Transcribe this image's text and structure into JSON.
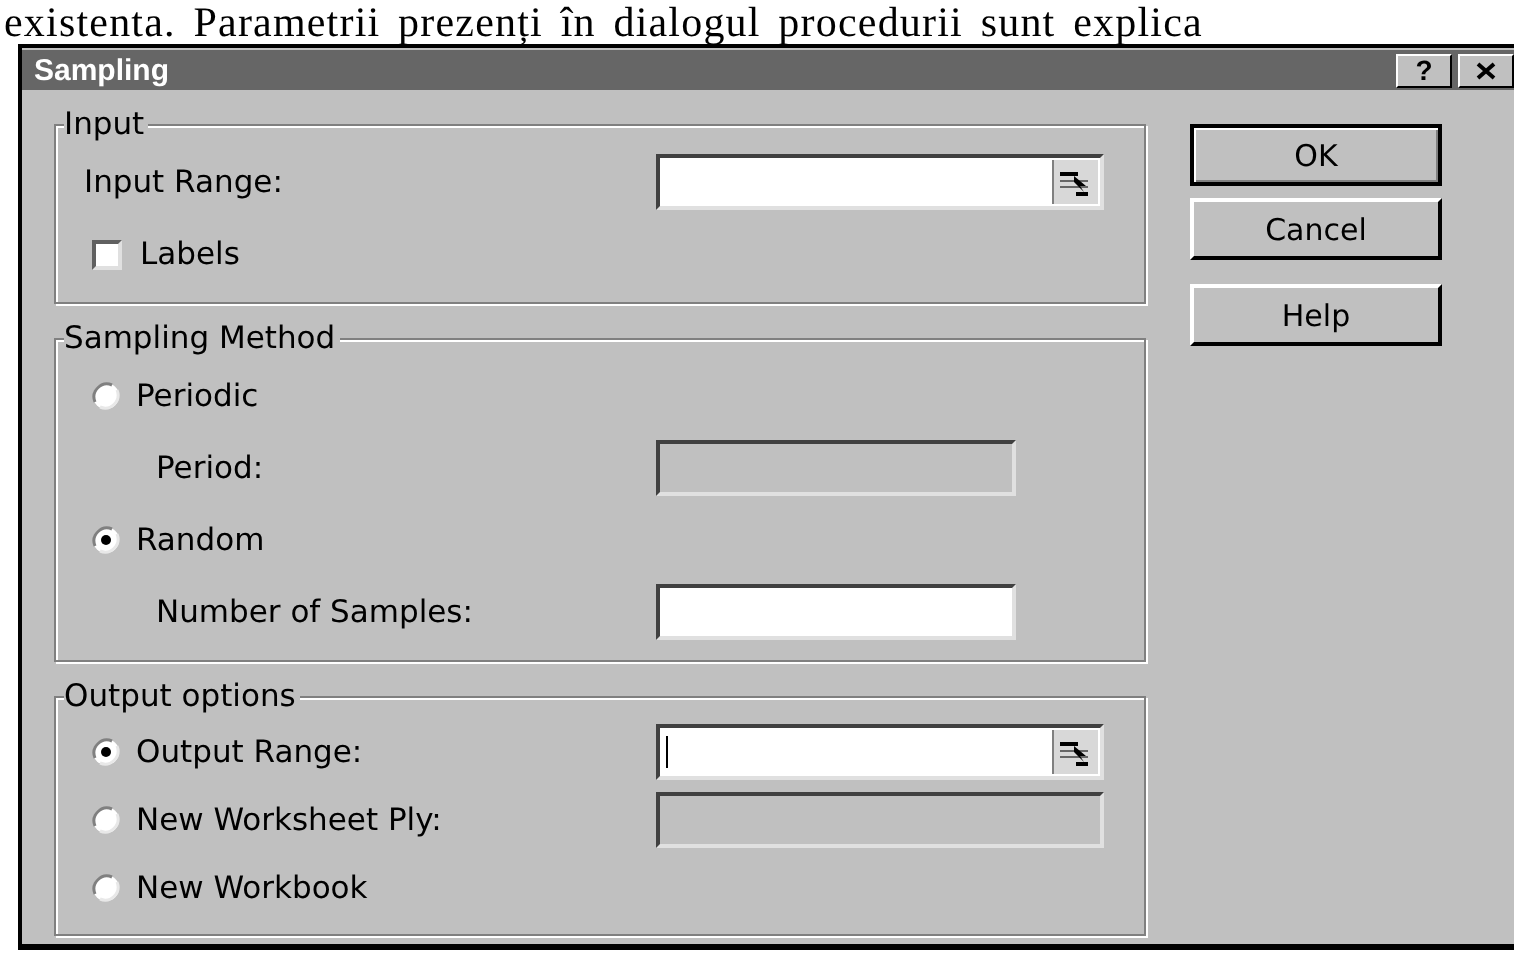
{
  "document_text": "existenta. Parametrii prezenți în dialogul procedurii sunt explica",
  "window": {
    "title": "Sampling",
    "help_button": "?"
  },
  "groups": [
    {
      "title": "Input",
      "rows": [
        {
          "kind": "field",
          "label": "Input Range:",
          "indent": false,
          "field": {
            "disabled": false,
            "ref_button": true,
            "focused": false
          }
        },
        {
          "kind": "checkbox",
          "label": "Labels",
          "checked": false
        }
      ]
    },
    {
      "title": "Sampling Method",
      "rows": [
        {
          "kind": "radio",
          "label": "Periodic",
          "selected": false
        },
        {
          "kind": "field",
          "label": "Period:",
          "indent": true,
          "field": {
            "disabled": true,
            "ref_button": false,
            "focused": false
          }
        },
        {
          "kind": "radio",
          "label": "Random",
          "selected": true
        },
        {
          "kind": "field",
          "label": "Number of Samples:",
          "indent": true,
          "field": {
            "disabled": false,
            "ref_button": false,
            "focused": false
          }
        }
      ]
    },
    {
      "title": "Output options",
      "rows": [
        {
          "kind": "radio",
          "label": "Output Range:",
          "selected": true,
          "field": {
            "disabled": false,
            "ref_button": true,
            "focused": true
          }
        },
        {
          "kind": "radio",
          "label": "New Worksheet Ply:",
          "selected": false,
          "field": {
            "disabled": true,
            "ref_button": false,
            "focused": false
          }
        },
        {
          "kind": "radio",
          "label": "New Workbook",
          "selected": false
        }
      ]
    }
  ],
  "buttons": [
    {
      "label": "OK",
      "default": true
    },
    {
      "label": "Cancel",
      "default": false
    },
    {
      "label": "Help",
      "default": false
    }
  ]
}
